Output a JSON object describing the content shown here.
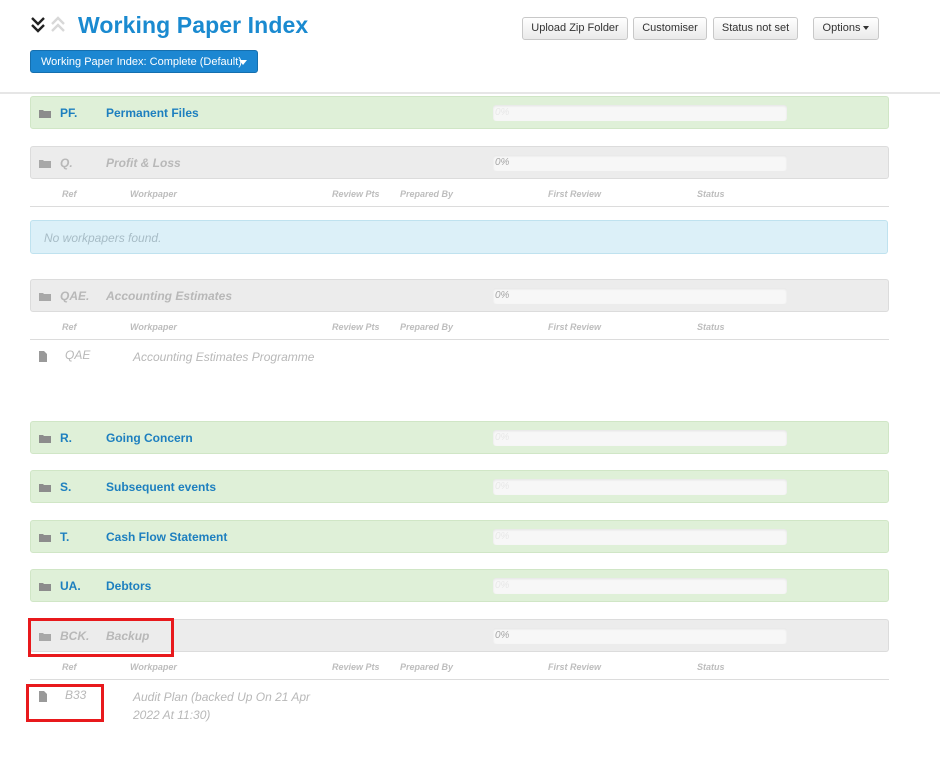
{
  "header": {
    "title": "Working Paper Index",
    "index_selector": "Working Paper Index: Complete (Default)",
    "buttons": {
      "upload": "Upload Zip Folder",
      "customiser": "Customiser",
      "status": "Status not set",
      "options": "Options"
    }
  },
  "table_columns": [
    "Ref",
    "Workpaper",
    "Review Pts",
    "Prepared By",
    "First Review",
    "Status"
  ],
  "sections": [
    {
      "code": "PF.",
      "name": "Permanent Files",
      "progress": "0%"
    },
    {
      "code": "Q.",
      "name": "Profit & Loss",
      "progress": "0%"
    },
    {
      "code": "QAE.",
      "name": "Accounting Estimates",
      "progress": "0%"
    },
    {
      "code": "R.",
      "name": "Going Concern",
      "progress": "0%"
    },
    {
      "code": "S.",
      "name": "Subsequent events",
      "progress": "0%"
    },
    {
      "code": "T.",
      "name": "Cash Flow Statement",
      "progress": "0%"
    },
    {
      "code": "UA.",
      "name": "Debtors",
      "progress": "0%"
    },
    {
      "code": "BCK.",
      "name": "Backup",
      "progress": "0%"
    }
  ],
  "empty_message": "No workpapers found.",
  "workpapers": [
    {
      "ref": "QAE",
      "name": "Accounting Estimates Programme"
    },
    {
      "ref": "B33",
      "name": "Audit Plan (backed Up On 21 Apr 2022 At 11:30)"
    }
  ],
  "colors": {
    "accent": "#1a8ad0",
    "highlight": "#e8191c",
    "section_active": "#dff0d8",
    "section_inactive": "#ececec"
  }
}
